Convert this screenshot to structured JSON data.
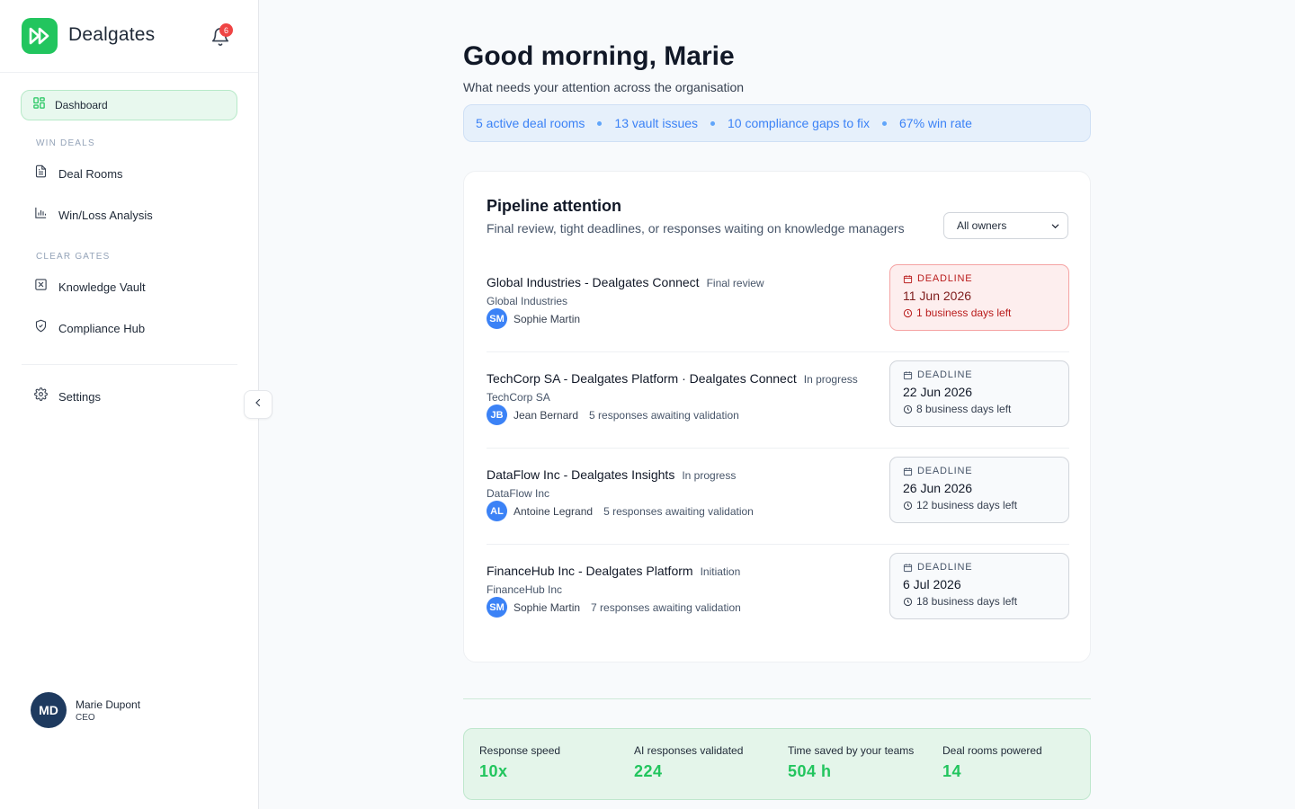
{
  "brand": {
    "name": "Dealgates",
    "notification_count": "6"
  },
  "nav": {
    "dashboard": "Dashboard",
    "section_win": "WIN DEALS",
    "deal_rooms": "Deal Rooms",
    "win_loss": "Win/Loss Analysis",
    "section_clear": "CLEAR GATES",
    "knowledge_vault": "Knowledge Vault",
    "compliance_hub": "Compliance Hub",
    "settings": "Settings"
  },
  "user": {
    "initials": "MD",
    "name": "Marie Dupont",
    "role": "CEO"
  },
  "header": {
    "greeting": "Good morning, Marie",
    "subtitle": "What needs your attention across the organisation"
  },
  "summary": [
    "5 active deal rooms",
    "13 vault issues",
    "10 compliance gaps to fix",
    "67% win rate"
  ],
  "pipeline": {
    "title": "Pipeline attention",
    "subtitle": "Final review, tight deadlines, or responses waiting on knowledge managers",
    "owner_filter": "All owners",
    "deadline_label": "DEADLINE",
    "deals": [
      {
        "title": "Global Industries - Dealgates Connect",
        "stage": "Final review",
        "company": "Global Industries",
        "owner_initials": "SM",
        "owner": "Sophie Martin",
        "awaiting": "",
        "date": "11 Jun 2026",
        "days_left": "1 business days left",
        "urgent": true
      },
      {
        "title": "TechCorp SA - Dealgates Platform · Dealgates Connect",
        "stage": "In progress",
        "company": "TechCorp SA",
        "owner_initials": "JB",
        "owner": "Jean Bernard",
        "awaiting": "5 responses awaiting validation",
        "date": "22 Jun 2026",
        "days_left": "8 business days left",
        "urgent": false
      },
      {
        "title": "DataFlow Inc - Dealgates Insights",
        "stage": "In progress",
        "company": "DataFlow Inc",
        "owner_initials": "AL",
        "owner": "Antoine Legrand",
        "awaiting": "5 responses awaiting validation",
        "date": "26 Jun 2026",
        "days_left": "12 business days left",
        "urgent": false
      },
      {
        "title": "FinanceHub Inc - Dealgates Platform",
        "stage": "Initiation",
        "company": "FinanceHub Inc",
        "owner_initials": "SM",
        "owner": "Sophie Martin",
        "awaiting": "7 responses awaiting validation",
        "date": "6 Jul 2026",
        "days_left": "18 business days left",
        "urgent": false
      }
    ]
  },
  "stats": [
    {
      "label": "Response speed",
      "value": "10x"
    },
    {
      "label": "AI responses validated",
      "value": "224"
    },
    {
      "label": "Time saved by your teams",
      "value": "504 h"
    },
    {
      "label": "Deal rooms powered",
      "value": "14"
    }
  ],
  "colors": {
    "brand_green": "#22c55e",
    "accent_blue": "#3b82f6",
    "urgent_red": "#ef4444",
    "avatar_navy": "#1e3a5f"
  },
  "icons": [
    "fast-forward-logo-icon",
    "bell-icon",
    "grid-icon",
    "document-icon",
    "bar-chart-icon",
    "vault-icon",
    "shield-icon",
    "gear-icon",
    "chevron-left-icon",
    "chevron-down-icon",
    "calendar-icon",
    "clock-icon"
  ]
}
